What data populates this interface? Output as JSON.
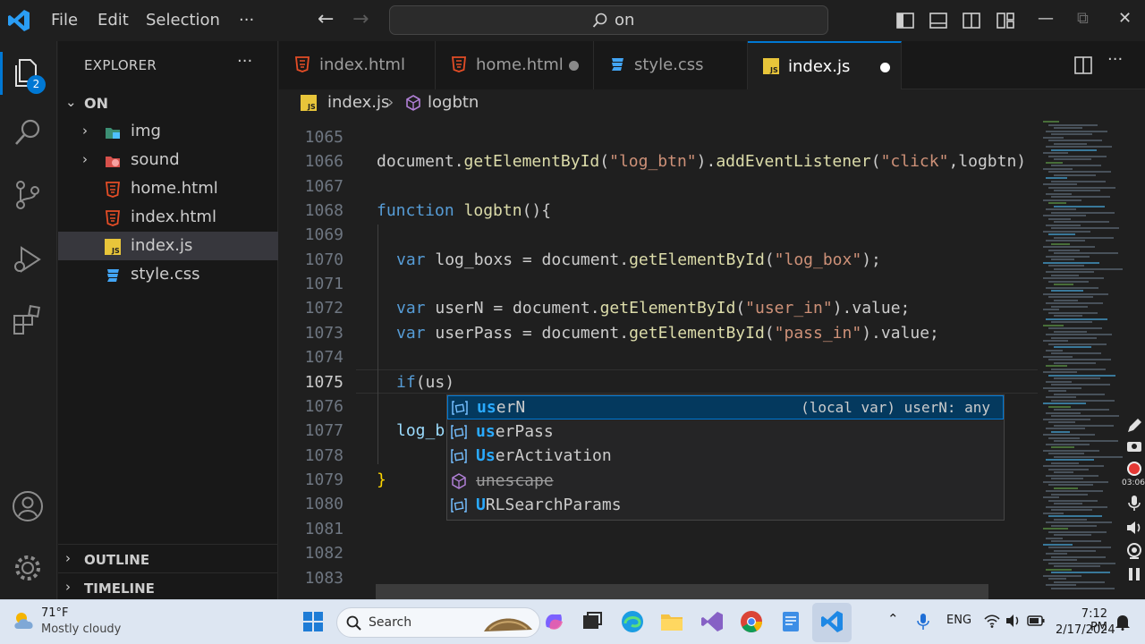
{
  "titlebar": {
    "menu": [
      "File",
      "Edit",
      "Selection",
      "···"
    ],
    "search_text": "on",
    "icons": [
      "vscode-logo",
      "back-arrow",
      "forward-arrow",
      "toggle-primary-sidebar",
      "toggle-panel",
      "toggle-secondary-sidebar",
      "customize-layout",
      "minimize",
      "restore",
      "close"
    ],
    "window_controls": {
      "minimize": "—",
      "restore": "⧉",
      "close": "✕"
    }
  },
  "activitybar": {
    "explorer_badge": "2",
    "icons": [
      "explorer-icon",
      "search-icon",
      "source-control-icon",
      "run-debug-icon",
      "extensions-icon",
      "accounts-icon",
      "manage-gear-icon"
    ]
  },
  "sidebar": {
    "title": "EXPLORER",
    "more": "···",
    "root": "ON",
    "items": [
      {
        "label": "img",
        "type": "folder",
        "icon": "image-folder-icon"
      },
      {
        "label": "sound",
        "type": "folder",
        "icon": "sound-folder-icon"
      },
      {
        "label": "home.html",
        "type": "file",
        "icon": "html-icon"
      },
      {
        "label": "index.html",
        "type": "file",
        "icon": "html-icon"
      },
      {
        "label": "index.js",
        "type": "file",
        "icon": "js-icon",
        "selected": true
      },
      {
        "label": "style.css",
        "type": "file",
        "icon": "css-icon"
      }
    ],
    "outline": "OUTLINE",
    "timeline": "TIMELINE"
  },
  "tabs": [
    {
      "label": "index.html",
      "icon": "html-icon",
      "active": false,
      "dirty": false
    },
    {
      "label": "home.html",
      "icon": "html-icon",
      "active": false,
      "dirty": true
    },
    {
      "label": "style.css",
      "icon": "css-icon",
      "active": false,
      "dirty": false
    },
    {
      "label": "index.js",
      "icon": "js-icon",
      "active": true,
      "dirty": true
    }
  ],
  "breadcrumb": {
    "file": "index.js",
    "symbol": "logbtn"
  },
  "editor": {
    "line_numbers": [
      "1065",
      "1066",
      "1067",
      "1068",
      "1069",
      "1070",
      "1071",
      "1072",
      "1073",
      "1074",
      "1075",
      "1076",
      "1077",
      "1078",
      "1079",
      "1080",
      "1081",
      "1082",
      "1083"
    ],
    "current_line": "1075",
    "lines": {
      "l1066": "document.getElementById(\"log_btn\").addEventListener(\"click\",logbtn)",
      "l1068": "function logbtn(){",
      "l1070": "var log_boxs = document.getElementById(\"log_box\");",
      "l1072": "var userN = document.getElementById(\"user_in\").value;",
      "l1073": "var userPass = document.getElementById(\"pass_in\").value;",
      "l1075": "if(us)",
      "l1077": "log_b",
      "l1079": "}"
    }
  },
  "suggest": {
    "items": [
      {
        "label": "userN",
        "match": "us",
        "detail": "(local var) userN: any",
        "selected": true,
        "icon": "variable-icon"
      },
      {
        "label": "userPass",
        "match": "us",
        "detail": "",
        "selected": false,
        "icon": "variable-icon"
      },
      {
        "label": "UserActivation",
        "match": "Us",
        "detail": "",
        "selected": false,
        "icon": "variable-icon"
      },
      {
        "label": "unescape",
        "match": "",
        "detail": "",
        "selected": false,
        "icon": "method-icon",
        "deprecated": true
      },
      {
        "label": "URLSearchParams",
        "match": "U",
        "detail": "",
        "selected": false,
        "icon": "variable-icon"
      }
    ]
  },
  "recording_time": "03:06",
  "taskbar": {
    "weather_temp": "71°F",
    "weather_desc": "Mostly cloudy",
    "search_label": "Search",
    "language": "ENG",
    "time": "7:12 PM",
    "date": "2/17/2024",
    "apps": [
      "windows-start-icon",
      "copilot-icon",
      "task-view-icon",
      "edge-icon",
      "file-explorer-icon",
      "visual-studio-icon",
      "chrome-icon",
      "notepad-icon",
      "vscode-icon"
    ],
    "colors": {
      "accent": "#0078d4"
    }
  }
}
